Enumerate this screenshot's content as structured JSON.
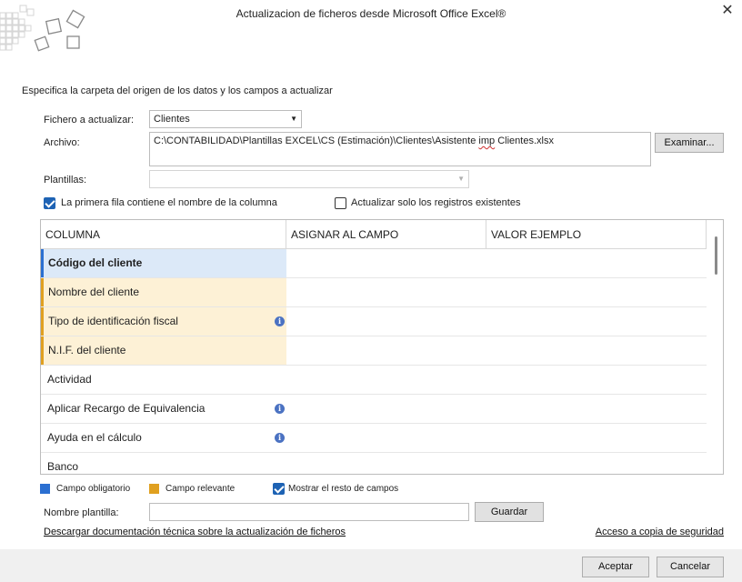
{
  "window": {
    "title": "Actualizacion de ficheros desde Microsoft Office Excel®",
    "close_glyph": "✕"
  },
  "subtitle": "Especifica la carpeta del origen de los datos y los campos a actualizar",
  "form": {
    "fichero_label": "Fichero a actualizar:",
    "fichero_value": "Clientes",
    "archivo_label": "Archivo:",
    "archivo_path_before": "C:\\CONTABILIDAD\\Plantillas EXCEL\\CS (Estimación)\\Clientes\\Asistente ",
    "archivo_path_squiggle": "imp",
    "archivo_path_after": " Clientes.xlsx",
    "examinar_label": "Examinar...",
    "plantillas_label": "Plantillas:",
    "plantillas_value": ""
  },
  "options": {
    "first_row_label": "La primera fila contiene el nombre de la columna",
    "first_row_checked": true,
    "only_existing_label": "Actualizar solo los registros existentes",
    "only_existing_checked": false
  },
  "grid": {
    "headers": [
      "COLUMNA",
      "ASIGNAR AL CAMPO",
      "VALOR EJEMPLO"
    ],
    "rows": [
      {
        "label": "Código del cliente",
        "kind": "required",
        "info": false
      },
      {
        "label": "Nombre del cliente",
        "kind": "relevant",
        "info": false
      },
      {
        "label": "Tipo de identificación fiscal",
        "kind": "relevant",
        "info": true
      },
      {
        "label": "N.I.F. del cliente",
        "kind": "relevant",
        "info": false
      },
      {
        "label": "Actividad",
        "kind": "normal",
        "info": false
      },
      {
        "label": "Aplicar Recargo de Equivalencia",
        "kind": "normal",
        "info": true
      },
      {
        "label": "Ayuda en el cálculo",
        "kind": "normal",
        "info": true
      },
      {
        "label": "Banco",
        "kind": "normal",
        "info": false
      }
    ]
  },
  "legend": {
    "required_label": "Campo obligatorio",
    "required_color": "#2b6fd1",
    "relevant_label": "Campo relevante",
    "relevant_color": "#e0a020",
    "show_rest_label": "Mostrar el resto de campos",
    "show_rest_checked": true
  },
  "template": {
    "name_label": "Nombre plantilla:",
    "name_value": "",
    "save_label": "Guardar"
  },
  "links": {
    "docs": "Descargar documentación técnica sobre la actualización de ficheros",
    "backup": "Acceso a copia de seguridad"
  },
  "footer": {
    "accept_label": "Aceptar",
    "cancel_label": "Cancelar"
  },
  "icons": {
    "info": "info-icon",
    "close": "close-icon",
    "dropdown": "chevron-down-icon"
  }
}
